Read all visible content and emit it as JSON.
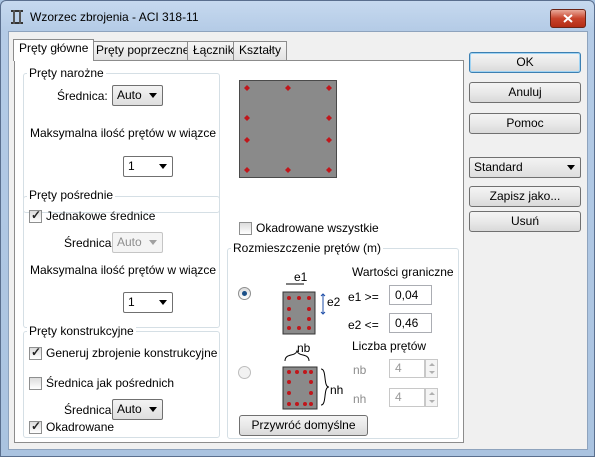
{
  "window": {
    "title": "Wzorzec zbrojenia - ACI 318-11"
  },
  "tabs": [
    {
      "label": "Pręty główne",
      "active": true
    },
    {
      "label": "Pręty poprzeczne",
      "active": false
    },
    {
      "label": "Łączniki",
      "active": false
    },
    {
      "label": "Kształty",
      "active": false
    }
  ],
  "corner_bars": {
    "group_label": "Pręty narożne",
    "diameter_label": "Średnica:",
    "diameter_value": "Auto",
    "max_bars_label": "Maksymalna ilość prętów w wiązce",
    "max_bars_value": "1"
  },
  "intermediate_bars": {
    "group_label": "Pręty pośrednie",
    "equal_diameters_label": "Jednakowe średnice",
    "equal_diameters_checked": true,
    "diameter_label": "Średnica:",
    "diameter_value": "Auto",
    "max_bars_label": "Maksymalna ilość prętów w wiązce",
    "max_bars_value": "1"
  },
  "construction_bars": {
    "group_label": "Pręty konstrukcyjne",
    "generate_label": "Generuj zbrojenie konstrukcyjne",
    "generate_checked": true,
    "same_as_intermediate_label": "Średnica jak pośrednich",
    "same_as_intermediate_checked": false,
    "diameter_label": "Średnica:",
    "diameter_value": "Auto",
    "tied_label": "Okadrowane",
    "tied_checked": true
  },
  "all_tied": {
    "label": "Okadrowane wszystkie",
    "checked": false
  },
  "distribution": {
    "group_label": "Rozmieszczenie prętów (m)",
    "limit_values_label": "Wartości graniczne",
    "e1_label": "e1 >=",
    "e1_value": "0,04",
    "e2_label": "e2 <=",
    "e2_value": "0,46",
    "diagram1_e1": "e1",
    "diagram1_e2": "e2",
    "bar_count_label": "Liczba prętów",
    "nb_label": "nb",
    "nb_value": "4",
    "nh_label": "nh",
    "nh_value": "4",
    "diagram2_nb": "nb",
    "diagram2_nh": "nh",
    "selected_option": "limit_values"
  },
  "restore_defaults_label": "Przywróć domyślne",
  "side_buttons": {
    "ok": "OK",
    "cancel": "Anuluj",
    "help": "Pomoc",
    "preset_value": "Standard",
    "save_as": "Zapisz jako...",
    "delete": "Usuń"
  },
  "colors": {
    "section_fill": "#8a8a8a",
    "bar_red": "#c0161b",
    "dimension_blue": "#1f4fa8"
  }
}
